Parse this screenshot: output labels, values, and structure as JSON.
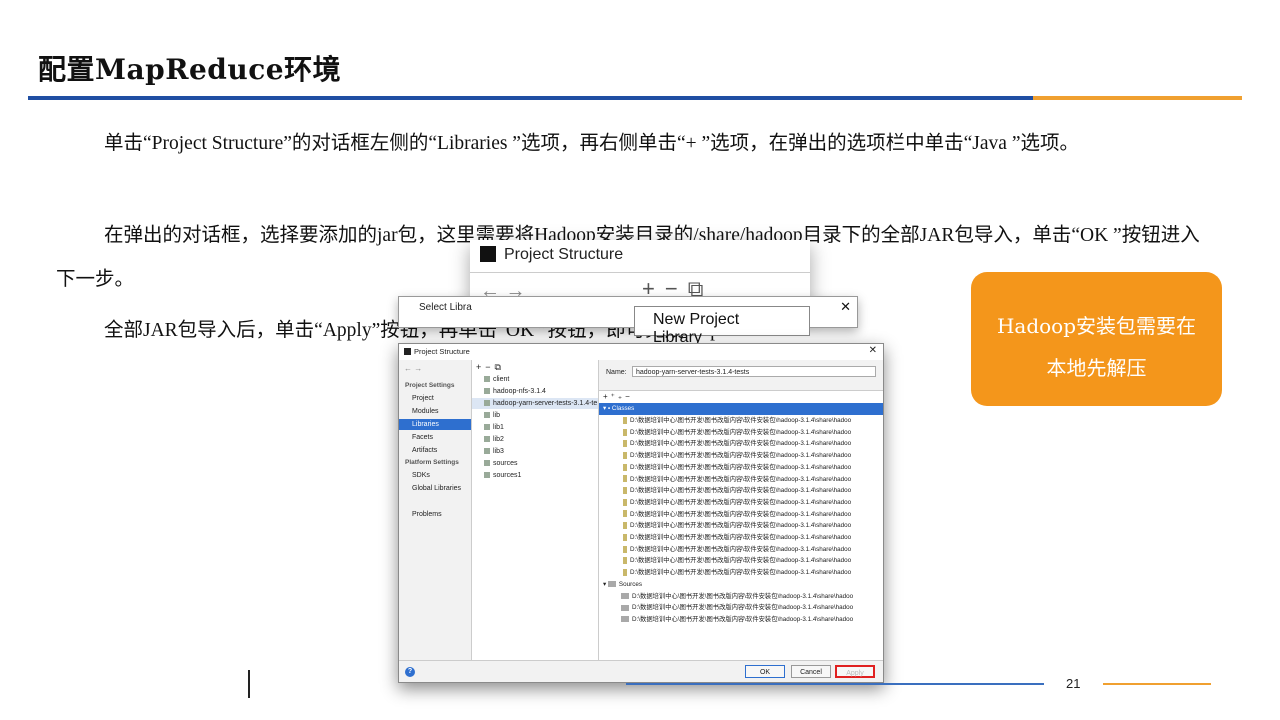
{
  "slide": {
    "title": "配置MapReduce环境",
    "paragraphs": [
      "单击“Project Structure”的对话框左侧的“Libraries ”选项，再右侧单击“+ ”选项，在弹出的选项栏中单击“Java ”选项。",
      "在弹出的对话框，选择要添加的jar包，这里需要将Hadoop安装目录的/share/hadoop目录下的全部JAR包导入，单击“OK ”按钮进入下一步。",
      "全部JAR包导入后，单击“Apply”按钮，再单击“OK ”按钮，即可完成MapRedu"
    ],
    "page_number": "21"
  },
  "callout": {
    "line1": "Hadoop安装包需要在",
    "line2": "本地先解压"
  },
  "back_dialog": {
    "title": "Project Structure",
    "popup_label": "New Project Library"
  },
  "select_dialog": {
    "title": "Select Libra",
    "hint": "...files or"
  },
  "dialog": {
    "title": "Project Structure",
    "project_settings_header": "Project Settings",
    "project_settings": [
      "Project",
      "Modules",
      "Libraries",
      "Facets",
      "Artifacts"
    ],
    "platform_settings_header": "Platform Settings",
    "platform_settings": [
      "SDKs",
      "Global Libraries"
    ],
    "problems": "Problems",
    "libraries": [
      "client",
      "hadoop-nfs-3.1.4",
      "hadoop-yarn-server-tests-3.1.4-te",
      "lib",
      "lib1",
      "lib2",
      "lib3",
      "sources",
      "sources1"
    ],
    "name_label": "Name:",
    "name_value": "hadoop-yarn-server-tests-3.1.4-tests",
    "classes_label": "Classes",
    "sources_label": "Sources",
    "path_text": "D:\\数据培训中心\\图书开发\\图书改版内容\\软件安装包\\hadoop-3.1.4\\share\\hadoo",
    "ok_label": "OK",
    "cancel_label": "Cancel",
    "apply_label": "Apply",
    "help_label": "?"
  }
}
